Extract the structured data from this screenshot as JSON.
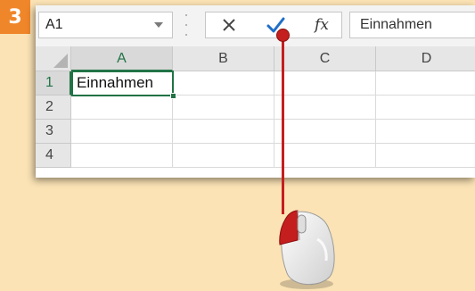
{
  "step": {
    "number": "3"
  },
  "formula_bar": {
    "name_box": "A1",
    "fx_label": "fx",
    "formula_value": "Einnahmen"
  },
  "columns": [
    "A",
    "B",
    "C",
    "D"
  ],
  "rows": [
    {
      "number": "1",
      "cells": [
        "Einnahmen",
        "",
        "",
        ""
      ]
    },
    {
      "number": "2",
      "cells": [
        "",
        "",
        "",
        ""
      ]
    },
    {
      "number": "3",
      "cells": [
        "",
        "",
        "",
        ""
      ]
    },
    {
      "number": "4",
      "cells": [
        "",
        "",
        "",
        ""
      ]
    }
  ],
  "selection": {
    "cell": "A1",
    "color": "#217346"
  },
  "colors": {
    "background": "#fbe3b5",
    "step_badge": "#f0862a",
    "pointer": "#c41e1e",
    "enter_check": "#1f6fc8"
  },
  "icons": {
    "cancel": "close-x-icon",
    "enter": "checkmark-icon",
    "insert_function": "fx-icon",
    "mouse": "mouse-icon"
  }
}
